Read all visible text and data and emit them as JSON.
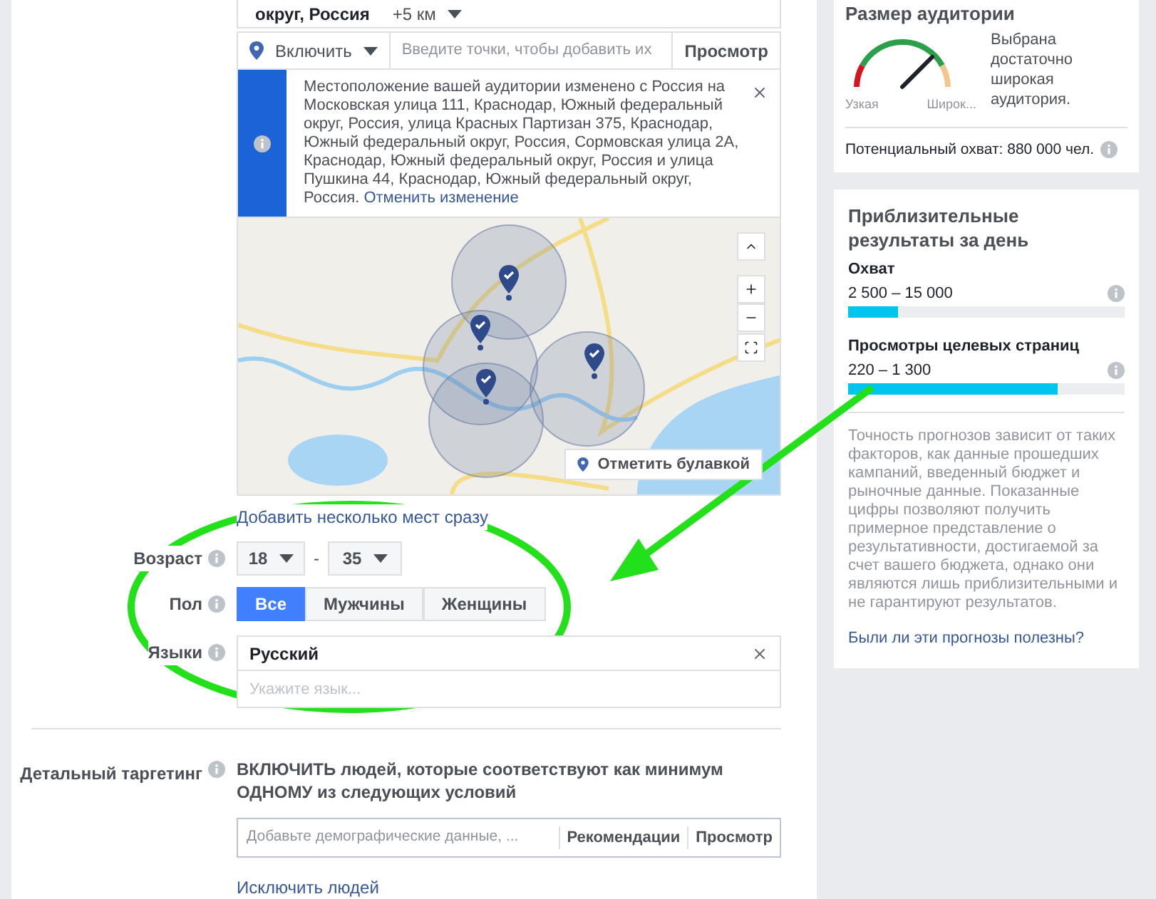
{
  "location": {
    "name": "округ, Россия",
    "radius": "+5 км"
  },
  "include_row": {
    "mode": "Включить",
    "placeholder": "Введите точки, чтобы добавить их",
    "browse": "Просмотр"
  },
  "notice": {
    "text": "Местоположение вашей аудитории изменено с Россия на Московская улица 111, Краснодар, Южный федеральный округ, Россия, улица Красных Партизан 375, Краснодар, Южный федеральный округ, Россия, Сормовская улица 2А, Краснодар, Южный федеральный округ, Россия и улица Пушкина 44, Краснодар, Южный федеральный округ, Россия.",
    "link": "Отменить изменение"
  },
  "map": {
    "pin_button": "Отметить булавкой"
  },
  "add_multiple_link": "Добавить несколько мест сразу",
  "age": {
    "label": "Возраст",
    "from": "18",
    "separator": "-",
    "to": "35"
  },
  "gender": {
    "label": "Пол",
    "options": [
      {
        "label": "Все",
        "selected": true
      },
      {
        "label": "Мужчины",
        "selected": false
      },
      {
        "label": "Женщины",
        "selected": false
      }
    ]
  },
  "languages": {
    "label": "Языки",
    "chosen": [
      {
        "label": "Русский"
      }
    ],
    "placeholder": "Укажите язык..."
  },
  "detailed": {
    "label": "Детальный таргетинг",
    "instruction": "ВКЛЮЧИТЬ людей, которые соответствуют как минимум ОДНОМУ из следующих условий",
    "placeholder": "Добавьте демографические данные, ...",
    "recommendations": "Рекомендации",
    "browse": "Просмотр",
    "exclude_link": "Исключить людей"
  },
  "audience_size": {
    "title": "Размер аудитории",
    "narrow": "Узкая",
    "wide": "Широк...",
    "description": "Выбрана достаточно широкая аудитория.",
    "potential_reach": "Потенциальный охват: 880 000 чел."
  },
  "estimates": {
    "title": "Приблизительные результаты за день",
    "metrics": [
      {
        "name": "Охват",
        "range": "2 500 – 15 000",
        "level": 0.18
      },
      {
        "name": "Просмотры целевых страниц",
        "range": "220 – 1 300",
        "level": 0.76
      }
    ],
    "disclaimer": "Точность прогнозов зависит от таких факторов, как данные прошедших кампаний, введенный бюджет и рыночные данные. Показанные цифры позволяют получить примерное представление о результативности, достигаемой за счет вашего бюджета, однако они являются лишь приблизительными и не гарантируют результатов.",
    "feedback_link": "Были ли эти прогнозы полезны?"
  }
}
